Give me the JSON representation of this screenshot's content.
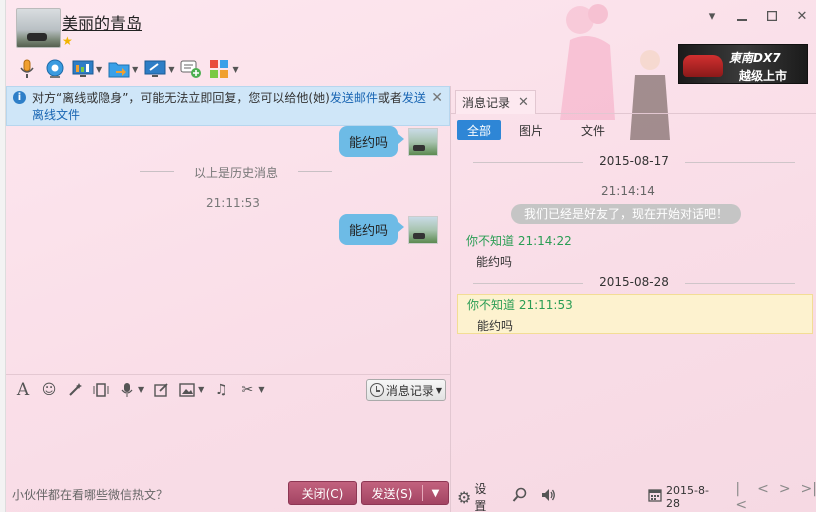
{
  "header": {
    "contact_name": "美丽的青岛",
    "ad_title": "東南DX7",
    "ad_subtitle": "越级上市"
  },
  "notice": {
    "text_before": "对方“离线或隐身”，可能无法立即回复，您可以给他(她)",
    "link_email": "发送邮件",
    "text_mid": "或者",
    "link_offline_file": "发送离线文件"
  },
  "chat": {
    "messages": [
      {
        "text": "能约吗"
      },
      {
        "text": "能约吗"
      }
    ],
    "history_divider": "以上是历史消息",
    "time": "21:11:53"
  },
  "input_toolbar": {
    "history_button": "消息记录"
  },
  "bottom": {
    "hot_link": "小伙伴都在看哪些微信热文？",
    "close_label": "关闭(C)",
    "send_label": "发送(S)"
  },
  "right_panel": {
    "tab_label": "消息记录",
    "subtabs": [
      "全部",
      "图片",
      "文件"
    ],
    "entries": {
      "date1": "2015-08-17",
      "sys_time": "21:14:14",
      "sys_msg": "我们已经是好友了，现在开始对话吧！",
      "msg1_head": "你不知道 21:14:22",
      "msg1_body": "能约吗",
      "date2": "2015-08-28",
      "msg2_head": "你不知道 21:11:53",
      "msg2_body": "能约吗"
    },
    "footer": {
      "settings_label": "设置",
      "date": "2015-8-28"
    }
  }
}
